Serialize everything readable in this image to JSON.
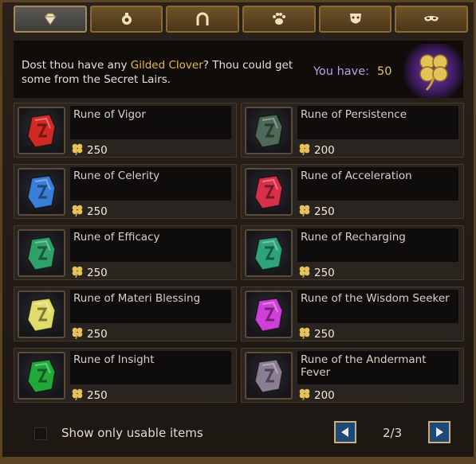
{
  "tabs": [
    {
      "icon": "diamond-icon",
      "active": true
    },
    {
      "icon": "potion-bag-icon",
      "active": false
    },
    {
      "icon": "horseshoe-icon",
      "active": false
    },
    {
      "icon": "paw-icon",
      "active": false
    },
    {
      "icon": "theater-mask-icon",
      "active": false
    },
    {
      "icon": "eye-mask-icon",
      "active": false
    }
  ],
  "banner": {
    "text_before": "Dost thou have any ",
    "highlight": "Gilded Clover",
    "text_after": "? Thou could get some from the Secret Lairs.",
    "you_have_label": "You have:",
    "you_have_value": "50",
    "currency_icon": "gilded-clover-icon"
  },
  "items": [
    {
      "name": "Rune of Vigor",
      "price": "250",
      "color": "#d02a24"
    },
    {
      "name": "Rune of Persistence",
      "price": "200",
      "color": "#4e6a56"
    },
    {
      "name": "Rune of Celerity",
      "price": "250",
      "color": "#3a7ed8"
    },
    {
      "name": "Rune of Acceleration",
      "price": "250",
      "color": "#d83048"
    },
    {
      "name": "Rune of Efficacy",
      "price": "250",
      "color": "#2ea068"
    },
    {
      "name": "Rune of Recharging",
      "price": "250",
      "color": "#2ea47a"
    },
    {
      "name": "Rune of Materi Blessing",
      "price": "250",
      "color": "#e0dc6a"
    },
    {
      "name": "Rune of the Wisdom Seeker",
      "price": "250",
      "color": "#d040d8"
    },
    {
      "name": "Rune of Insight",
      "price": "250",
      "color": "#22a83a"
    },
    {
      "name": "Rune of the Andermant Fever",
      "price": "200",
      "color": "#8a7e94"
    }
  ],
  "footer": {
    "checkbox_label": "Show only usable items",
    "page": "2/3"
  }
}
